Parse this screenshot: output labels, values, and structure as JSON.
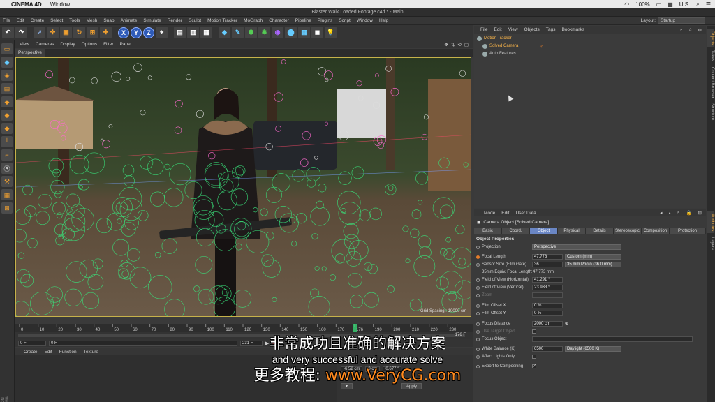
{
  "macbar": {
    "app_name": "CINEMA 4D",
    "menu": "Window",
    "battery": "100%",
    "locale": "U.S.",
    "colors": {
      "bg": "#e9e9e9"
    }
  },
  "window_title": "Blaster Walk Loaded Footage.c4d * - Main",
  "app_menu": [
    "File",
    "Edit",
    "Create",
    "Select",
    "Tools",
    "Mesh",
    "Snap",
    "Animate",
    "Simulate",
    "Render",
    "Sculpt",
    "Motion Tracker",
    "MoGraph",
    "Character",
    "Pipeline",
    "Plugins",
    "Script",
    "Window",
    "Help"
  ],
  "layout": {
    "label": "Layout:",
    "value": "Startup"
  },
  "toolbar_axes": [
    "X",
    "Y",
    "Z"
  ],
  "viewport": {
    "menu": [
      "View",
      "Cameras",
      "Display",
      "Options",
      "Filter",
      "Panel"
    ],
    "tab": "Perspective",
    "grid_spacing": "Grid Spacing : 10000 cm"
  },
  "timeline": {
    "ticks": [
      "0",
      "10",
      "20",
      "30",
      "40",
      "50",
      "60",
      "70",
      "80",
      "90",
      "100",
      "110",
      "120",
      "130",
      "140",
      "150",
      "160",
      "170",
      "176",
      "190",
      "200",
      "210",
      "220",
      "230"
    ],
    "end_frame": "176 F",
    "start_field": "0 F",
    "current_field": "0 F",
    "end_field": "231 F"
  },
  "materials_menu": [
    "Create",
    "Edit",
    "Function",
    "Texture"
  ],
  "coords": {
    "y_value": "-6.52 cm",
    "x_value": "0 cm",
    "angle": "0.677 °",
    "apply": "Apply"
  },
  "objects_menu": [
    "File",
    "Edit",
    "View",
    "Objects",
    "Tags",
    "Bookmarks"
  ],
  "objects": [
    {
      "name": "Motion Tracker",
      "selected": true
    },
    {
      "name": "Solved Camera",
      "selected": true
    },
    {
      "name": "Auto Features",
      "selected": false
    }
  ],
  "right_tabs": [
    "Objects",
    "Takes",
    "Content Browser",
    "Structure",
    "Attributes",
    "Layers"
  ],
  "attributes": {
    "menu": [
      "Mode",
      "Edit",
      "User Data"
    ],
    "header": "Camera Object [Solved Camera]",
    "tabs": [
      "Basic",
      "Coord.",
      "Object",
      "Physical",
      "Details",
      "Stereoscopic",
      "Composition",
      "Protection"
    ],
    "active_tab": "Object",
    "section": "Object Properties",
    "props": {
      "projection_label": "Projection",
      "projection_value": "Perspective",
      "focal_label": "Focal Length",
      "focal_value": "47.773",
      "focal_preset": "Custom (mm)",
      "sensor_label": "Sensor Size (Film Gate)",
      "sensor_value": "36",
      "sensor_preset": "35 mm Photo (36.0 mm)",
      "equiv_label": "35mm Equiv. Focal Length:",
      "equiv_value": "47.773 mm",
      "fovh_label": "Field of View (Horizontal)",
      "fovh_value": "41.291 °",
      "fovv_label": "Field of View (Vertical)",
      "fovv_value": "23.933 °",
      "zoom_label": "Zoom",
      "offx_label": "Film Offset X",
      "offx_value": "0 %",
      "offy_label": "Film Offset Y",
      "offy_value": "0 %",
      "focusd_label": "Focus Distance",
      "focusd_value": "2000 cm",
      "use_target_label": "Use Target Object",
      "focus_obj_label": "Focus Object",
      "wb_label": "White Balance (K)",
      "wb_value": "6500",
      "wb_preset": "Daylight (6500 K)",
      "affect_label": "Affect Lights Only",
      "export_label": "Export to Compositing"
    }
  },
  "subtitles": {
    "cn": "非常成功且准确的解决方案",
    "en": "and very successful and accurate solve",
    "wm_prefix": "更多教程: ",
    "wm_url": "www.VeryCG.com"
  },
  "colors": {
    "accent": "#6a86c4",
    "selection": "#ffb84a",
    "track_green": "#39e07a",
    "viewport_border": "#c6b24a"
  }
}
